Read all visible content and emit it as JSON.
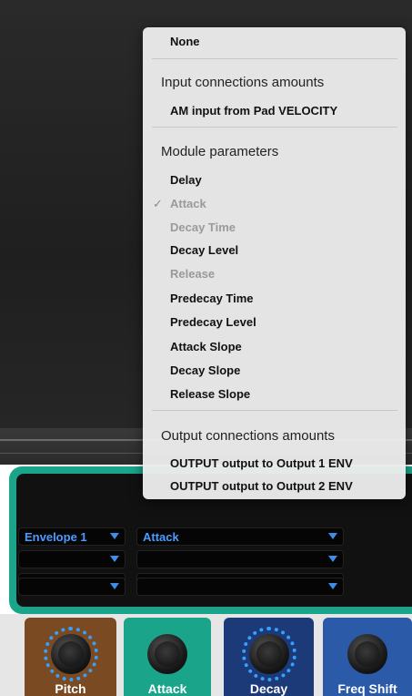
{
  "menu": {
    "none_label": "None",
    "input_header": "Input connections amounts",
    "input_items": [
      "AM input from Pad VELOCITY"
    ],
    "module_header": "Module parameters",
    "module_items": [
      {
        "label": "Delay",
        "enabled": true,
        "checked": false
      },
      {
        "label": "Attack",
        "enabled": false,
        "checked": true
      },
      {
        "label": "Decay Time",
        "enabled": false,
        "checked": false
      },
      {
        "label": "Decay Level",
        "enabled": true,
        "checked": false
      },
      {
        "label": "Release",
        "enabled": false,
        "checked": false
      },
      {
        "label": "Predecay Time",
        "enabled": true,
        "checked": false
      },
      {
        "label": "Predecay Level",
        "enabled": true,
        "checked": false
      },
      {
        "label": "Attack Slope",
        "enabled": true,
        "checked": false
      },
      {
        "label": "Decay Slope",
        "enabled": true,
        "checked": false
      },
      {
        "label": "Release Slope",
        "enabled": true,
        "checked": false
      }
    ],
    "output_header": "Output connections amounts",
    "output_items": [
      "OUTPUT output to Output 1 ENV",
      "OUTPUT output to Output 2 ENV"
    ],
    "check_mark": "✓"
  },
  "mod_matrix": {
    "rows": [
      {
        "source": "Envelope 1",
        "param": "Attack"
      },
      {
        "source": "",
        "param": ""
      },
      {
        "source": "",
        "param": ""
      },
      {
        "source": "",
        "param": ""
      }
    ]
  },
  "knobs": [
    {
      "label": "Pitch",
      "bg": "#7a4a22",
      "ring": true
    },
    {
      "label": "Attack",
      "bg": "#1aa58a",
      "ring": false
    },
    {
      "label": "Decay",
      "bg": "#1c3a78",
      "ring": true
    },
    {
      "label": "Freq Shift",
      "bg": "#2a5aa8",
      "ring": false
    }
  ],
  "colors": {
    "accent_blue": "#4a9cff",
    "panel_green": "#1aa58a"
  }
}
